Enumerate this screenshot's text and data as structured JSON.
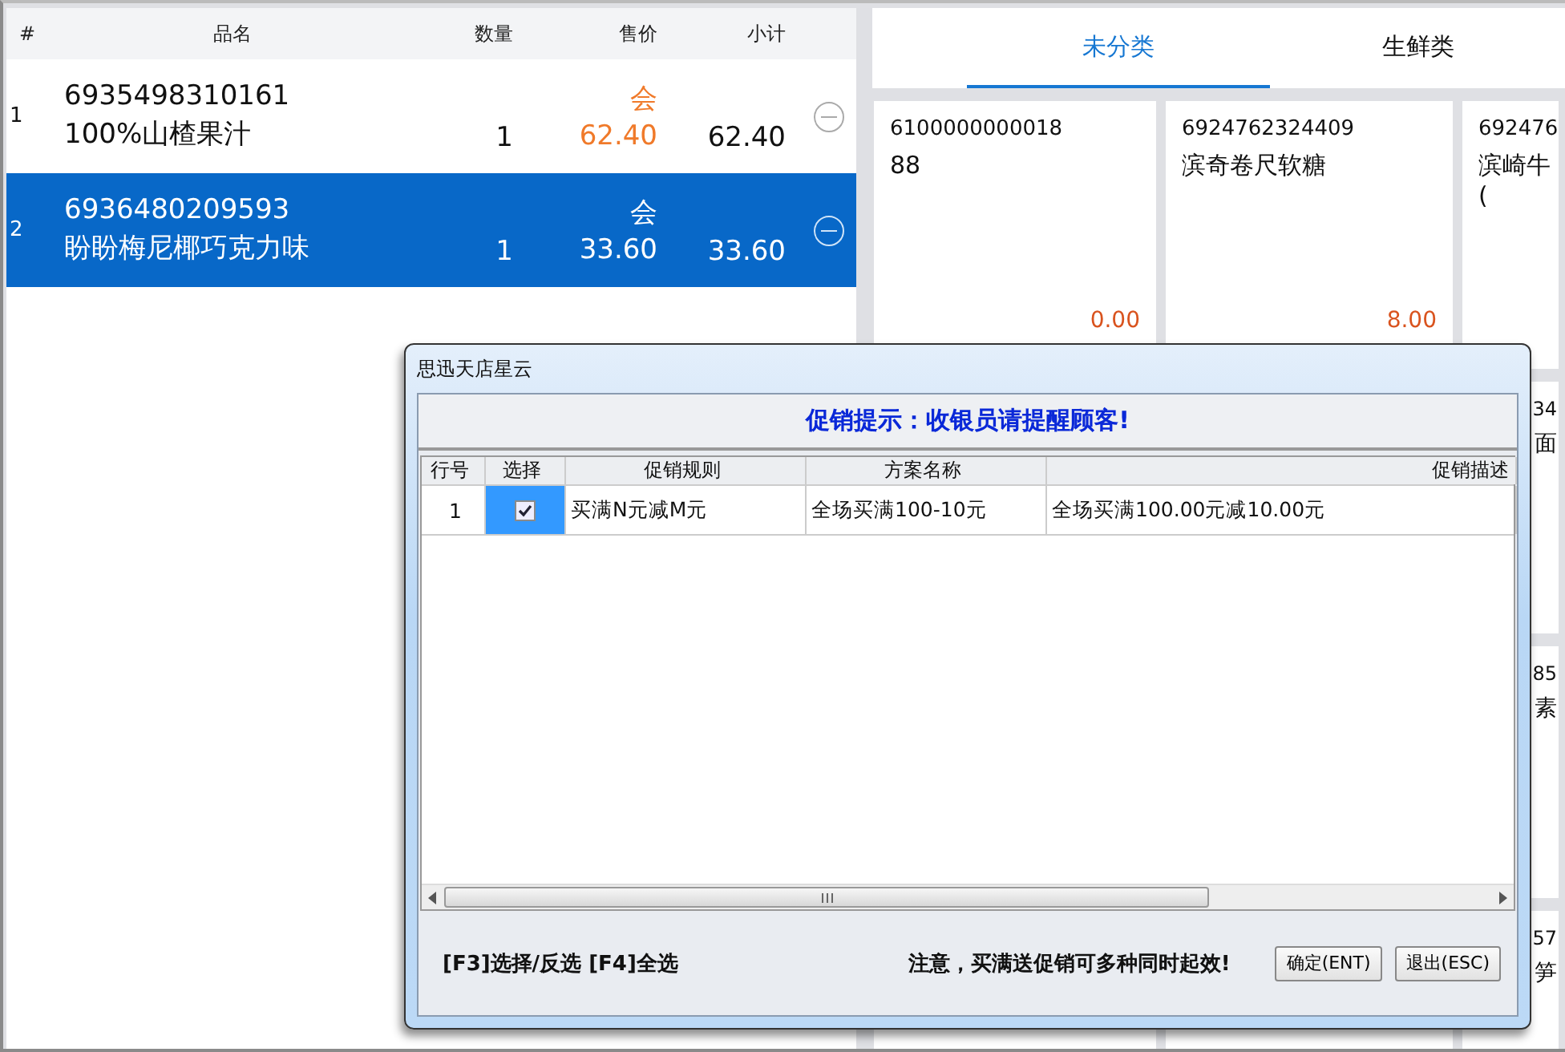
{
  "cart": {
    "columns": [
      "#",
      "品名",
      "数量",
      "售价",
      "小计"
    ],
    "rows": [
      {
        "index": "1",
        "barcode": "6935498310161",
        "name": "100%山楂果汁",
        "qty": "1",
        "member_tag": "会",
        "price": "62.40",
        "subtotal": "62.40",
        "selected": false
      },
      {
        "index": "2",
        "barcode": "6936480209593",
        "name": "盼盼梅尼椰巧克力味",
        "qty": "1",
        "member_tag": "会",
        "price": "33.60",
        "subtotal": "33.60",
        "selected": true
      }
    ]
  },
  "category_tabs": [
    {
      "label": "未分类",
      "selected": true
    },
    {
      "label": "生鲜类",
      "selected": false
    }
  ],
  "products": [
    {
      "kind": "full",
      "code": "6100000000018",
      "name_lines": [
        "88"
      ],
      "price": "0.00"
    },
    {
      "kind": "full",
      "code": "6924762324409",
      "name_lines": [
        "滨奇卷尺软糖"
      ],
      "price": "8.00"
    },
    {
      "kind": "full",
      "code": "692476",
      "name_lines": [
        "滨崎牛",
        "("
      ]
    },
    {
      "kind": "covered"
    },
    {
      "kind": "covered"
    },
    {
      "kind": "partial",
      "code": "34",
      "name_lines": [
        "面"
      ]
    },
    {
      "kind": "covered"
    },
    {
      "kind": "covered"
    },
    {
      "kind": "partial",
      "code": "85",
      "name_lines": [
        "素"
      ]
    },
    {
      "kind": "hidden"
    },
    {
      "kind": "hidden"
    },
    {
      "kind": "partial",
      "code": "57",
      "name_lines": [
        "笋"
      ]
    }
  ],
  "dialog": {
    "title": "思迅天店星云",
    "header": "促销提示：收银员请提醒顾客!",
    "columns": [
      "行号",
      "选择",
      "促销规则",
      "方案名称",
      "促销描述"
    ],
    "rows": [
      {
        "line": "1",
        "checked": true,
        "selected": true,
        "rule": "买满N元减M元",
        "plan": "全场买满100-10元",
        "desc": "全场买满100.00元减10.00元"
      }
    ],
    "hint": "[F3]选择/反选 [F4]全选",
    "notice": "注意，买满送促销可多种同时起效!",
    "buttons": [
      "确定(ENT)",
      "退出(ESC)"
    ]
  }
}
